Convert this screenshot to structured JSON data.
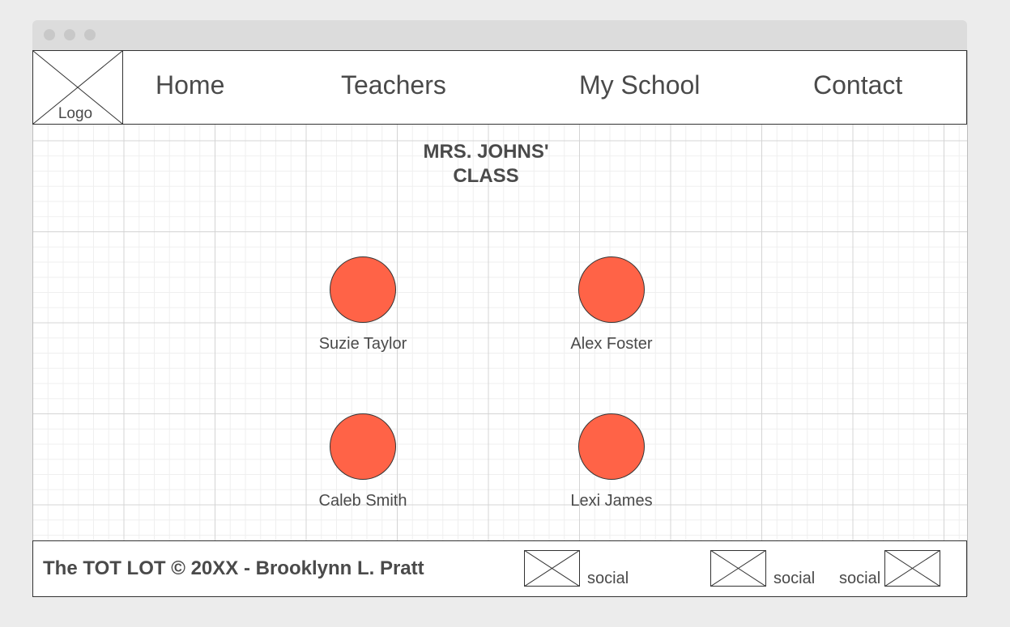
{
  "navbar": {
    "logo_label": "Logo",
    "items": [
      {
        "label": "Home"
      },
      {
        "label": "Teachers"
      },
      {
        "label": "My School"
      },
      {
        "label": "Contact"
      }
    ]
  },
  "main": {
    "title_line1": "MRS. JOHNS'",
    "title_line2": "CLASS",
    "students": [
      {
        "name": "Suzie Taylor"
      },
      {
        "name": "Alex Foster"
      },
      {
        "name": "Caleb Smith"
      },
      {
        "name": "Lexi James"
      }
    ],
    "avatar_color": "#ff6347"
  },
  "footer": {
    "copyright": "The TOT LOT © 20XX - Brooklynn L. Pratt",
    "socials": [
      {
        "label": "social"
      },
      {
        "label": "social"
      },
      {
        "label": "social"
      }
    ]
  }
}
